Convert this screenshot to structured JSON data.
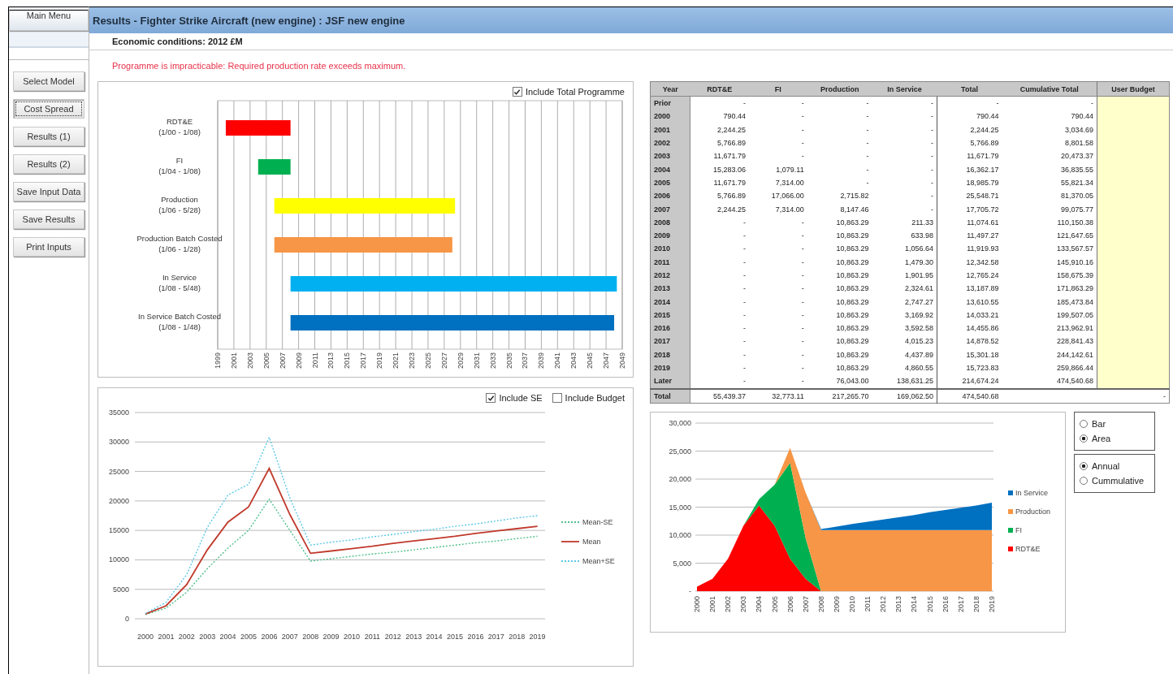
{
  "sidebar": {
    "main_menu": "Main Menu",
    "buttons": [
      {
        "label": "Select Model",
        "selected": false
      },
      {
        "label": "Cost Spread",
        "selected": true
      },
      {
        "label": "Results (1)",
        "selected": false
      },
      {
        "label": "Results (2)",
        "selected": false
      },
      {
        "label": "Save Input Data",
        "selected": false
      },
      {
        "label": "Save Results",
        "selected": false
      },
      {
        "label": "Print Inputs",
        "selected": false
      }
    ]
  },
  "header": {
    "title": "Results - Fighter Strike Aircraft (new engine) : JSF new engine",
    "subtitle": "Economic conditions: 2012 £M"
  },
  "warning": "Programme is impracticable: Required production rate exceeds maximum.",
  "gantt": {
    "option": {
      "label": "Include Total Programme",
      "checked": true
    },
    "tasks": [
      {
        "name": "RDT&E",
        "range": "(1/00 - 1/08)",
        "color": "#ff0000"
      },
      {
        "name": "FI",
        "range": "(1/04 - 1/08)",
        "color": "#00b050"
      },
      {
        "name": "Production",
        "range": "(1/06 - 5/28)",
        "color": "#ffff00"
      },
      {
        "name": "Production Batch Costed",
        "range": "(1/06 - 1/28)",
        "color": "#f79646"
      },
      {
        "name": "In Service",
        "range": "(1/08 - 5/48)",
        "color": "#00b0f0"
      },
      {
        "name": "In Service Batch Costed",
        "range": "(1/08 - 1/48)",
        "color": "#0070c0"
      }
    ],
    "axis_labels": [
      "1999",
      "2001",
      "2003",
      "2005",
      "2007",
      "2009",
      "2011",
      "2013",
      "2015",
      "2017",
      "2019",
      "2021",
      "2023",
      "2025",
      "2027",
      "2029",
      "2031",
      "2033",
      "2035",
      "2037",
      "2039",
      "2041",
      "2043",
      "2045",
      "2047",
      "2049"
    ]
  },
  "cost_table": {
    "columns": [
      "Year",
      "RDT&E",
      "FI",
      "Production",
      "In Service",
      "Total",
      "Cumulative Total",
      "User Budget"
    ],
    "rows": [
      {
        "year": "Prior",
        "values": [
          "-",
          "-",
          "-",
          "-",
          "-",
          "-"
        ]
      },
      {
        "year": "2000",
        "values": [
          "790.44",
          "-",
          "-",
          "-",
          "790.44",
          "790.44"
        ]
      },
      {
        "year": "2001",
        "values": [
          "2,244.25",
          "-",
          "-",
          "-",
          "2,244.25",
          "3,034.69"
        ]
      },
      {
        "year": "2002",
        "values": [
          "5,766.89",
          "-",
          "-",
          "-",
          "5,766.89",
          "8,801.58"
        ]
      },
      {
        "year": "2003",
        "values": [
          "11,671.79",
          "-",
          "-",
          "-",
          "11,671.79",
          "20,473.37"
        ]
      },
      {
        "year": "2004",
        "values": [
          "15,283.06",
          "1,079.11",
          "-",
          "-",
          "16,362.17",
          "36,835.55"
        ]
      },
      {
        "year": "2005",
        "values": [
          "11,671.79",
          "7,314.00",
          "-",
          "-",
          "18,985.79",
          "55,821.34"
        ]
      },
      {
        "year": "2006",
        "values": [
          "5,766.89",
          "17,066.00",
          "2,715.82",
          "-",
          "25,548.71",
          "81,370.05"
        ]
      },
      {
        "year": "2007",
        "values": [
          "2,244.25",
          "7,314.00",
          "8,147.46",
          "-",
          "17,705.72",
          "99,075.77"
        ]
      },
      {
        "year": "2008",
        "values": [
          "-",
          "-",
          "10,863.29",
          "211.33",
          "11,074.61",
          "110,150.38"
        ]
      },
      {
        "year": "2009",
        "values": [
          "-",
          "-",
          "10,863.29",
          "633.98",
          "11,497.27",
          "121,647.65"
        ]
      },
      {
        "year": "2010",
        "values": [
          "-",
          "-",
          "10,863.29",
          "1,056.64",
          "11,919.93",
          "133,567.57"
        ]
      },
      {
        "year": "2011",
        "values": [
          "-",
          "-",
          "10,863.29",
          "1,479.30",
          "12,342.58",
          "145,910.16"
        ]
      },
      {
        "year": "2012",
        "values": [
          "-",
          "-",
          "10,863.29",
          "1,901.95",
          "12,765.24",
          "158,675.39"
        ]
      },
      {
        "year": "2013",
        "values": [
          "-",
          "-",
          "10,863.29",
          "2,324.61",
          "13,187.89",
          "171,863.29"
        ]
      },
      {
        "year": "2014",
        "values": [
          "-",
          "-",
          "10,863.29",
          "2,747.27",
          "13,610.55",
          "185,473.84"
        ]
      },
      {
        "year": "2015",
        "values": [
          "-",
          "-",
          "10,863.29",
          "3,169.92",
          "14,033.21",
          "199,507.05"
        ]
      },
      {
        "year": "2016",
        "values": [
          "-",
          "-",
          "10,863.29",
          "3,592.58",
          "14,455.86",
          "213,962.91"
        ]
      },
      {
        "year": "2017",
        "values": [
          "-",
          "-",
          "10,863.29",
          "4,015.23",
          "14,878.52",
          "228,841.43"
        ]
      },
      {
        "year": "2018",
        "values": [
          "-",
          "-",
          "10,863.29",
          "4,437.89",
          "15,301.18",
          "244,142.61"
        ]
      },
      {
        "year": "2019",
        "values": [
          "-",
          "-",
          "10,863.29",
          "4,860.55",
          "15,723.83",
          "259,866.44"
        ]
      },
      {
        "year": "Later",
        "values": [
          "-",
          "-",
          "76,043.00",
          "138,631.25",
          "214,674.24",
          "474,540.68"
        ]
      }
    ],
    "total": {
      "label": "Total",
      "values": [
        "55,439.37",
        "32,773.11",
        "217,265.70",
        "169,062.50",
        "474,540.68"
      ],
      "budget": "-"
    }
  },
  "line_chart": {
    "options": [
      {
        "label": "Include SE",
        "checked": true
      },
      {
        "label": "Include Budget",
        "checked": false
      }
    ],
    "chart_data": {
      "type": "line",
      "x": [
        "2000",
        "2001",
        "2002",
        "2003",
        "2004",
        "2005",
        "2006",
        "2007",
        "2008",
        "2009",
        "2010",
        "2011",
        "2012",
        "2013",
        "2014",
        "2015",
        "2016",
        "2017",
        "2018",
        "2019"
      ],
      "yticks": [
        0,
        5000,
        10000,
        15000,
        20000,
        25000,
        30000,
        35000
      ],
      "ylim": [
        0,
        35000
      ],
      "grid": true,
      "legend": true,
      "series": [
        {
          "name": "Mean-SE",
          "color": "#4fc08d",
          "line_style": "dotted",
          "values": [
            700,
            1800,
            4500,
            8500,
            12000,
            15000,
            20300,
            15000,
            9800,
            10200,
            10600,
            11000,
            11300,
            11700,
            12100,
            12500,
            12900,
            13200,
            13600,
            14000
          ]
        },
        {
          "name": "Mean",
          "color": "#c0392b",
          "line_style": "solid",
          "values": [
            800,
            2200,
            5800,
            11700,
            16400,
            19000,
            25500,
            17700,
            11100,
            11500,
            11900,
            12300,
            12800,
            13200,
            13600,
            14000,
            14500,
            14900,
            15300,
            15700
          ]
        },
        {
          "name": "Mean+SE",
          "color": "#5bc8e8",
          "line_style": "dotted",
          "values": [
            900,
            2800,
            7500,
            15500,
            21000,
            22800,
            30800,
            20500,
            12500,
            13000,
            13400,
            13900,
            14300,
            14800,
            15200,
            15700,
            16100,
            16600,
            17100,
            17500
          ]
        }
      ]
    }
  },
  "area_chart": {
    "chart_data": {
      "type": "area",
      "stacked": true,
      "x": [
        "2000",
        "2001",
        "2002",
        "2003",
        "2004",
        "2005",
        "2006",
        "2007",
        "2008",
        "2009",
        "2010",
        "2011",
        "2012",
        "2013",
        "2014",
        "2015",
        "2016",
        "2017",
        "2018",
        "2019"
      ],
      "ylim": [
        0,
        30000
      ],
      "grid": true,
      "legend": true,
      "yticks": [
        {
          "value": 0,
          "label": "-"
        },
        {
          "value": 5000,
          "label": "5,000"
        },
        {
          "value": 10000,
          "label": "10,000"
        },
        {
          "value": 15000,
          "label": "15,000"
        },
        {
          "value": 20000,
          "label": "20,000"
        },
        {
          "value": 25000,
          "label": "25,000"
        },
        {
          "value": 30000,
          "label": "30,000"
        }
      ],
      "series": [
        {
          "name": "RDT&E",
          "color": "#ff0000",
          "values": [
            800,
            2200,
            5800,
            11700,
            15300,
            11700,
            5800,
            2200,
            0,
            0,
            0,
            0,
            0,
            0,
            0,
            0,
            0,
            0,
            0,
            0
          ]
        },
        {
          "name": "FI",
          "color": "#00b050",
          "values": [
            0,
            0,
            0,
            0,
            1100,
            7300,
            17100,
            7300,
            0,
            0,
            0,
            0,
            0,
            0,
            0,
            0,
            0,
            0,
            0,
            0
          ]
        },
        {
          "name": "Production",
          "color": "#f79646",
          "values": [
            0,
            0,
            0,
            0,
            0,
            0,
            2700,
            8100,
            10900,
            10900,
            10900,
            10900,
            10900,
            10900,
            10900,
            10900,
            10900,
            10900,
            10900,
            10900
          ]
        },
        {
          "name": "In Service",
          "color": "#0070c0",
          "values": [
            0,
            0,
            0,
            0,
            0,
            0,
            0,
            0,
            200,
            600,
            1100,
            1500,
            1900,
            2300,
            2700,
            3200,
            3600,
            4000,
            4400,
            4900
          ]
        }
      ]
    }
  },
  "chart_type": [
    {
      "label": "Bar",
      "selected": false
    },
    {
      "label": "Area",
      "selected": true
    }
  ],
  "period": [
    {
      "label": "Annual",
      "selected": true
    },
    {
      "label": "Cummulative",
      "selected": false
    }
  ]
}
